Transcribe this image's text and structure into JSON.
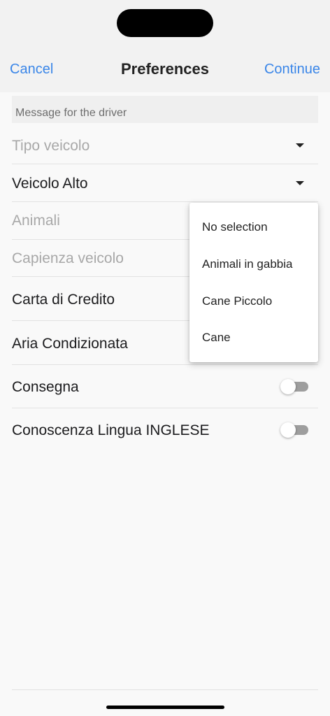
{
  "nav": {
    "cancel_label": "Cancel",
    "title": "Preferences",
    "continue_label": "Continue"
  },
  "message_placeholder": "Message for the driver",
  "fields": {
    "tipo_veicolo": "Tipo veicolo",
    "veicolo_alto": "Veicolo Alto",
    "animali": "Animali",
    "capienza_veicolo": "Capienza veicolo",
    "carta_di_credito": "Carta di Credito",
    "aria_condizionata": "Aria Condizionata",
    "consegna": "Consegna",
    "lingua_inglese": "Conoscenza Lingua INGLESE"
  },
  "toggles": {
    "consegna": false,
    "lingua_inglese": false
  },
  "dropdown": {
    "options": [
      "No selection",
      "Animali in gabbia",
      "Cane Piccolo",
      "Cane"
    ]
  },
  "colors": {
    "accent": "#3a86e8",
    "placeholder": "#a8a8a8",
    "toggle_off": "#9e9e9e"
  },
  "icons": {
    "dropdown_caret": "caret-down-icon"
  }
}
